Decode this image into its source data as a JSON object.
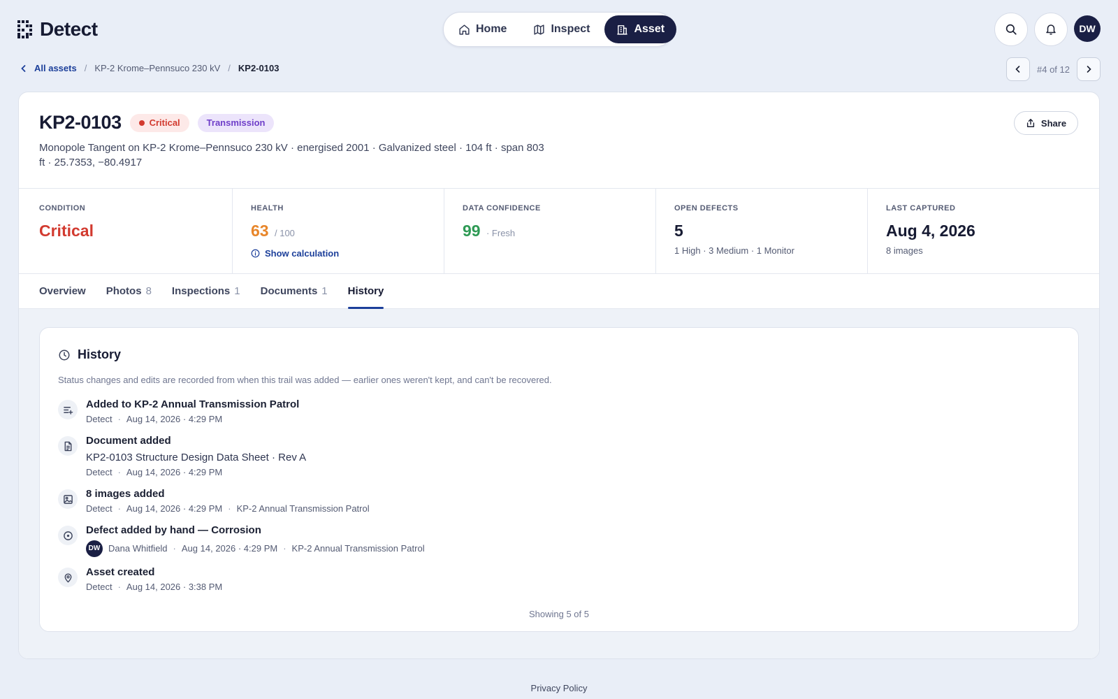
{
  "app": {
    "logo_text": "Detect"
  },
  "nav": {
    "items": [
      {
        "label": "Home",
        "icon": "home-icon",
        "active": false
      },
      {
        "label": "Inspect",
        "icon": "map-icon",
        "active": false
      },
      {
        "label": "Asset",
        "icon": "building-icon",
        "active": true
      }
    ]
  },
  "user": {
    "initials": "DW"
  },
  "breadcrumb": {
    "back_label": "All assets",
    "line_label": "KP-2 Krome–Pennsuco 230 kV",
    "current": "KP2-0103"
  },
  "pager": {
    "text": "#4 of 12"
  },
  "asset": {
    "id": "KP2-0103",
    "status_badge": "Critical",
    "type_badge": "Transmission",
    "description": "Monopole Tangent on KP-2 Krome–Pennsuco 230 kV · energised 2001 · Galvanized steel · 104 ft · span 803 ft · 25.7353, −80.4917",
    "share_label": "Share",
    "colors": {
      "critical": "#d23a2f",
      "health": "#e8862a",
      "confidence": "#2f9a55",
      "accent": "#1c3f9a"
    }
  },
  "stats": {
    "condition": {
      "label": "CONDITION",
      "value": "Critical"
    },
    "health": {
      "label": "HEALTH",
      "value": "63",
      "suffix": "/ 100",
      "link": "Show calculation"
    },
    "confidence": {
      "label": "DATA CONFIDENCE",
      "value": "99",
      "suffix": "· Fresh"
    },
    "defects": {
      "label": "OPEN DEFECTS",
      "value": "5",
      "sub": "1 High · 3 Medium · 1 Monitor"
    },
    "captured": {
      "label": "LAST CAPTURED",
      "value": "Aug 4, 2026",
      "sub": "8 images"
    }
  },
  "tabs": [
    {
      "label": "Overview",
      "count": ""
    },
    {
      "label": "Photos",
      "count": "8"
    },
    {
      "label": "Inspections",
      "count": "1"
    },
    {
      "label": "Documents",
      "count": "1"
    },
    {
      "label": "History",
      "count": "",
      "active": true
    }
  ],
  "history": {
    "title": "History",
    "note": "Status changes and edits are recorded from when this trail was added — earlier ones weren't kept, and can't be recovered.",
    "events": [
      {
        "icon": "list-add-icon",
        "title": "Added to KP-2 Annual Transmission Patrol",
        "actor": "Detect",
        "time": "Aug 14, 2026 · 4:29 PM"
      },
      {
        "icon": "document-icon",
        "title": "Document added",
        "detail": "KP2-0103 Structure Design Data Sheet · Rev A",
        "actor": "Detect",
        "time": "Aug 14, 2026 · 4:29 PM"
      },
      {
        "icon": "image-icon",
        "title": "8 images added",
        "actor": "Detect",
        "time": "Aug 14, 2026 · 4:29 PM",
        "context": "KP-2 Annual Transmission Patrol"
      },
      {
        "icon": "circle-dot-icon",
        "title": "Defect added by hand — Corrosion",
        "actor_initials": "DW",
        "actor": "Dana Whitfield",
        "time": "Aug 14, 2026 · 4:29 PM",
        "context": "KP-2 Annual Transmission Patrol"
      },
      {
        "icon": "map-pin-icon",
        "title": "Asset created",
        "actor": "Detect",
        "time": "Aug 14, 2026 · 3:38 PM"
      }
    ],
    "footer": "Showing 5 of 5"
  },
  "footer": {
    "privacy": "Privacy Policy"
  }
}
